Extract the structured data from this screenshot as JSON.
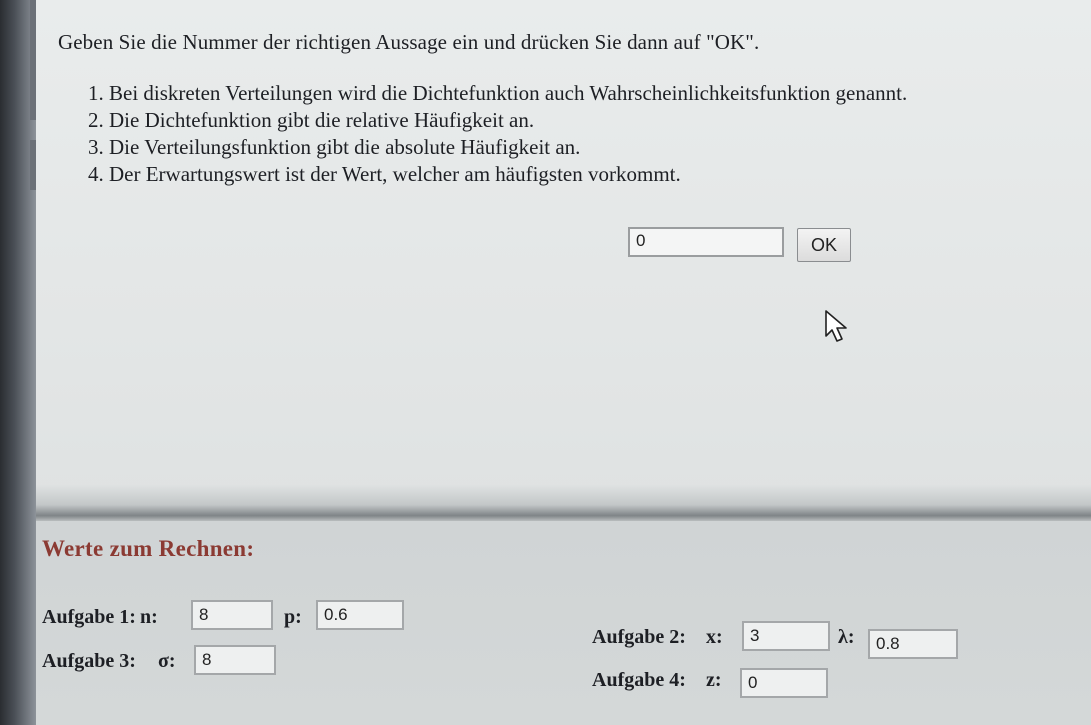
{
  "question": "Geben Sie die Nummer der richtigen Aussage ein und drücken Sie dann auf \"OK\".",
  "options": [
    "1. Bei diskreten Verteilungen wird die Dichtefunktion auch Wahrscheinlichkeitsfunktion genannt.",
    "2. Die Dichtefunktion gibt die relative Häufigkeit an.",
    "3. Die Verteilungsfunktion gibt die absolute Häufigkeit an.",
    "4. Der Erwartungswert ist der Wert, welcher am häufigsten vorkommt."
  ],
  "answer": {
    "value": "0",
    "ok_label": "OK"
  },
  "values_section": {
    "heading": "Werte zum Rechnen:",
    "task1": {
      "label": "Aufgabe 1:",
      "n_label": "n:",
      "n_value": "8",
      "p_label": "p:",
      "p_value": "0.6"
    },
    "task2": {
      "label": "Aufgabe 2:",
      "x_label": "x:",
      "x_value": "3",
      "lambda_label": "λ:",
      "lambda_value": "0.8"
    },
    "task3": {
      "label": "Aufgabe 3:",
      "sigma_label": "σ:",
      "sigma_value": "8"
    },
    "task4": {
      "label": "Aufgabe 4:",
      "z_label": "z:",
      "z_value": "0"
    }
  },
  "colors": {
    "heading": "#8b3a33",
    "background": "#e3e6e6"
  },
  "icons": {
    "cursor": "arrow-cursor-icon"
  }
}
